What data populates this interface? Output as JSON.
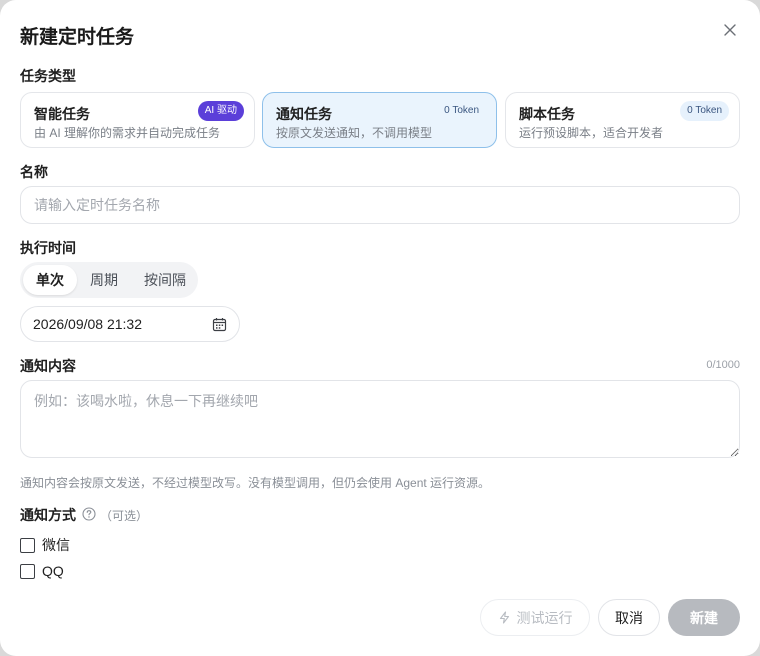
{
  "dialog": {
    "title": "新建定时任务"
  },
  "task_type": {
    "label": "任务类型",
    "options": [
      {
        "name": "智能任务",
        "desc": "由 AI 理解你的需求并自动完成任务",
        "badge": "AI 驱动",
        "selected": false
      },
      {
        "name": "通知任务",
        "desc": "按原文发送通知，不调用模型",
        "badge": "0 Token",
        "selected": true
      },
      {
        "name": "脚本任务",
        "desc": "运行预设脚本，适合开发者",
        "badge": "0 Token",
        "selected": false
      }
    ]
  },
  "name_field": {
    "label": "名称",
    "placeholder": "请输入定时任务名称",
    "value": ""
  },
  "schedule": {
    "label": "执行时间",
    "modes": [
      "单次",
      "周期",
      "按间隔"
    ],
    "active_mode": "单次",
    "datetime": "2026/09/08 21:32"
  },
  "content": {
    "label": "通知内容",
    "counter": "0/1000",
    "placeholder": "例如：该喝水啦，休息一下再继续吧",
    "hint": "通知内容会按原文发送，不经过模型改写。没有模型调用，但仍会使用 Agent 运行资源。"
  },
  "notify": {
    "label": "通知方式",
    "optional": "（可选）",
    "channels": [
      {
        "label": "微信",
        "checked": false
      },
      {
        "label": "QQ",
        "checked": false
      }
    ]
  },
  "actions": {
    "test": "测试运行",
    "cancel": "取消",
    "create": "新建"
  },
  "colors": {
    "accent": "#5b3fd9",
    "selected_bg": "#eaf4fd",
    "selected_border": "#8ec0ea",
    "primary_disabled": "#b7babf"
  },
  "icons": {
    "close": "close-icon",
    "calendar": "calendar-icon",
    "help": "help-circle-icon",
    "bolt": "bolt-icon"
  }
}
